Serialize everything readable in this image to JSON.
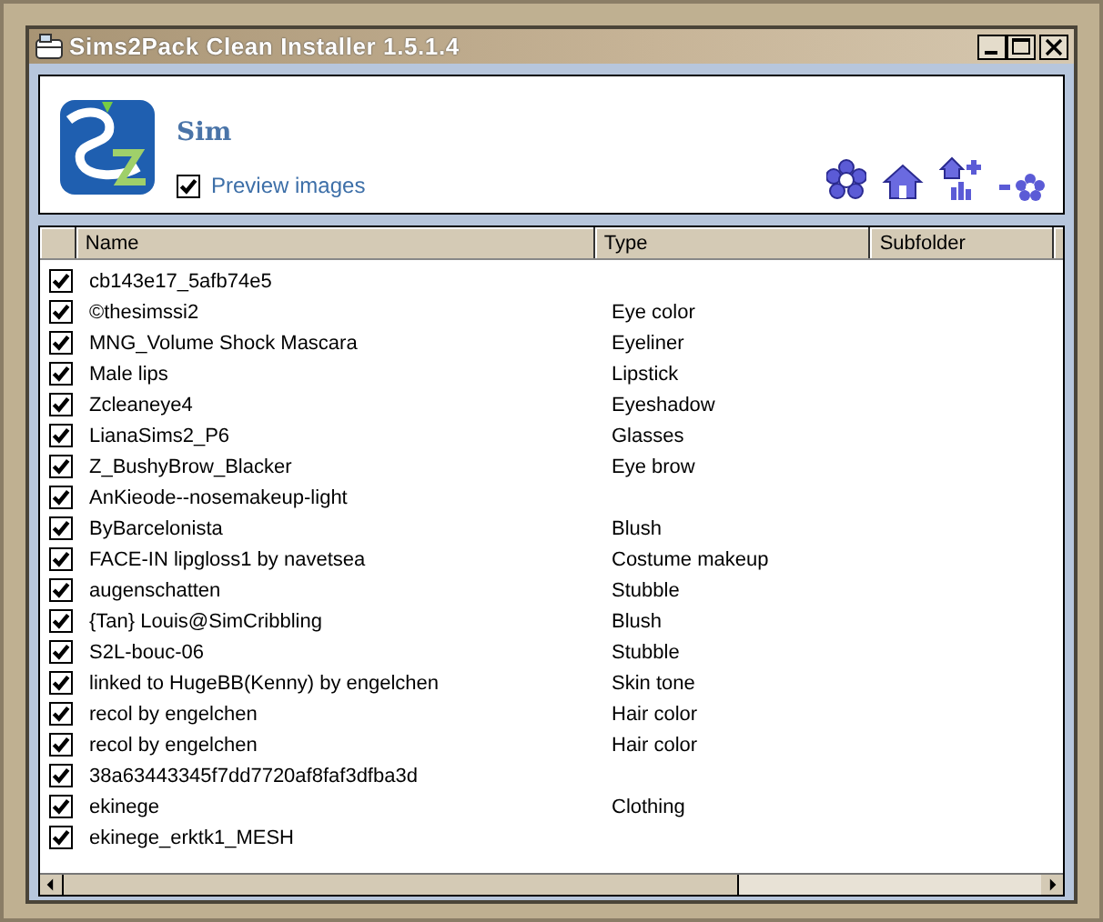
{
  "window": {
    "title": "Sims2Pack Clean Installer 1.5.1.4"
  },
  "header": {
    "title": "Sim",
    "preview_images": {
      "label": "Preview images",
      "checked": true
    }
  },
  "table": {
    "columns": [
      "Name",
      "Type",
      "Subfolder"
    ],
    "rows": [
      {
        "checked": true,
        "name": "cb143e17_5afb74e5"
      },
      {
        "checked": true,
        "name": "©thesimssi2",
        "type": "Eye color"
      },
      {
        "checked": true,
        "name": "MNG_Volume Shock Mascara",
        "type": "Eyeliner"
      },
      {
        "checked": true,
        "name": "Male lips",
        "type": "Lipstick"
      },
      {
        "checked": true,
        "name": "Zcleaneye4",
        "type": "Eyeshadow"
      },
      {
        "checked": true,
        "name": "LianaSims2_P6",
        "type": "Glasses"
      },
      {
        "checked": true,
        "name": "Z_BushyBrow_Blacker",
        "type": "Eye brow"
      },
      {
        "checked": true,
        "name": "AnKieode--nosemakeup-light"
      },
      {
        "checked": true,
        "name": "ByBarcelonista",
        "type": "Blush"
      },
      {
        "checked": true,
        "name": "FACE-IN lipgloss1 by navetsea",
        "type": "Costume makeup"
      },
      {
        "checked": true,
        "name": "augenschatten",
        "type": "Stubble"
      },
      {
        "checked": true,
        "name": "{Tan} Louis@SimCribbling",
        "type": "Blush"
      },
      {
        "checked": true,
        "name": "S2L-bouc-06",
        "type": "Stubble"
      },
      {
        "checked": true,
        "name": "linked to HugeBB(Kenny) by engelchen",
        "type": "Skin tone"
      },
      {
        "checked": true,
        "name": "recol by engelchen",
        "type": "Hair color"
      },
      {
        "checked": true,
        "name": "recol by engelchen",
        "type": "Hair color"
      },
      {
        "checked": true,
        "name": "38a63443345f7dd7720af8faf3dfba3d"
      },
      {
        "checked": true,
        "name": "ekinege",
        "type": "Clothing"
      },
      {
        "checked": true,
        "name": "ekinege_erktk1_MESH"
      }
    ]
  }
}
